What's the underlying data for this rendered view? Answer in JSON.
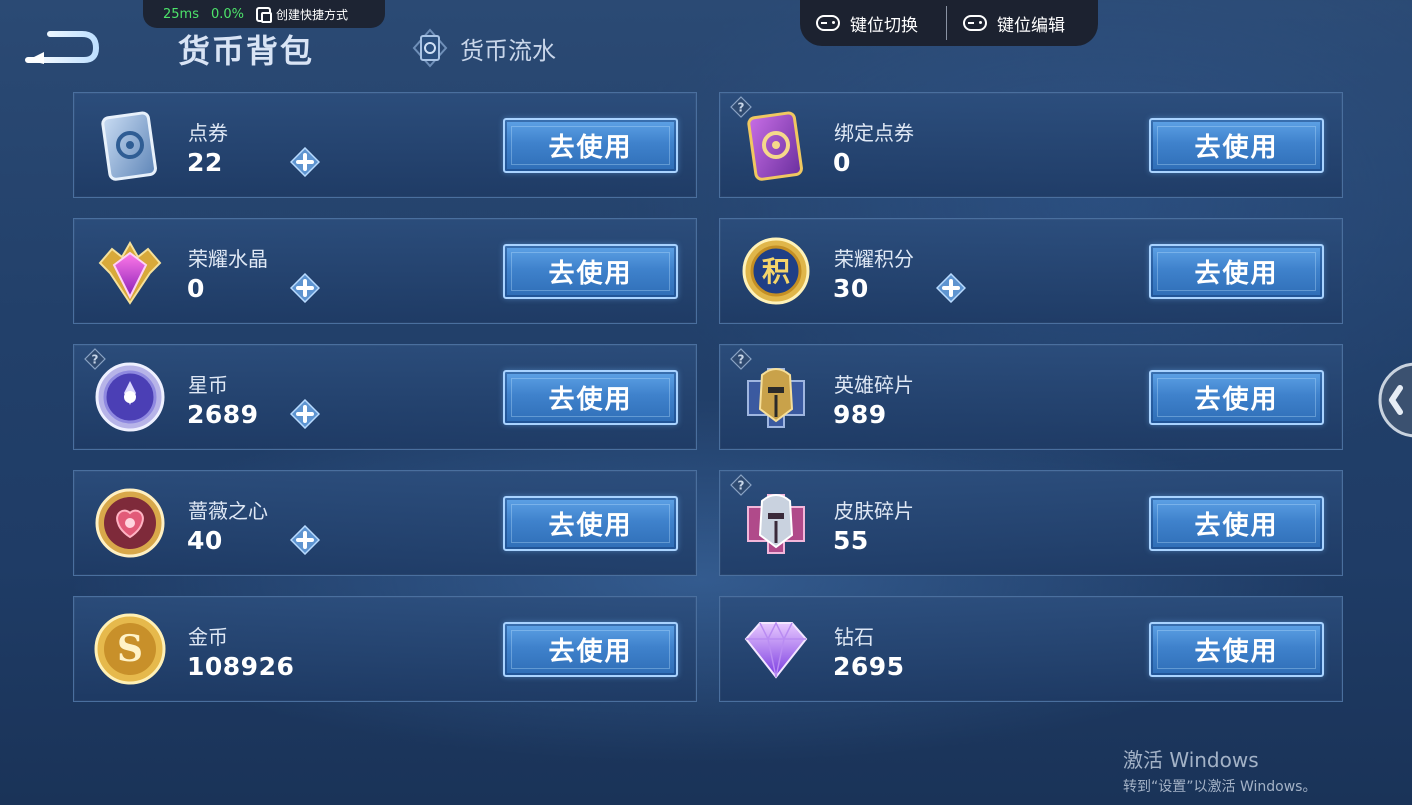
{
  "overlay": {
    "ping": "25ms",
    "loss": "0.0%",
    "shortcut_label": "创建快捷方式"
  },
  "keymap": {
    "switch_label": "键位切换",
    "edit_label": "键位编辑"
  },
  "header": {
    "title": "货币背包",
    "tab_flow_label": "货币流水"
  },
  "use_label": "去使用",
  "cards": [
    {
      "name": "点券",
      "amount": "22",
      "icon": "voucher-icon",
      "plus": true,
      "help": false
    },
    {
      "name": "绑定点券",
      "amount": "0",
      "icon": "bound-voucher-icon",
      "plus": false,
      "help": true
    },
    {
      "name": "荣耀水晶",
      "amount": "0",
      "icon": "glory-crystal-icon",
      "plus": true,
      "help": false
    },
    {
      "name": "荣耀积分",
      "amount": "30",
      "icon": "glory-points-icon",
      "plus": true,
      "help": false
    },
    {
      "name": "星币",
      "amount": "2689",
      "icon": "star-coin-icon",
      "plus": true,
      "help": true
    },
    {
      "name": "英雄碎片",
      "amount": "989",
      "icon": "hero-fragment-icon",
      "plus": false,
      "help": true
    },
    {
      "name": "蔷薇之心",
      "amount": "40",
      "icon": "rose-heart-icon",
      "plus": true,
      "help": false
    },
    {
      "name": "皮肤碎片",
      "amount": "55",
      "icon": "skin-fragment-icon",
      "plus": false,
      "help": true
    },
    {
      "name": "金币",
      "amount": "108926",
      "icon": "gold-coin-icon",
      "plus": false,
      "help": false
    },
    {
      "name": "钻石",
      "amount": "2695",
      "icon": "diamond-icon",
      "plus": false,
      "help": false
    }
  ],
  "watermark": {
    "line1": "激活 Windows",
    "line2": "转到“设置”以激活 Windows。"
  },
  "colors": {
    "background": "#22406a",
    "card_border": "#4a6f9e",
    "button": "#3f82cc",
    "perf_green": "#4de36a"
  }
}
